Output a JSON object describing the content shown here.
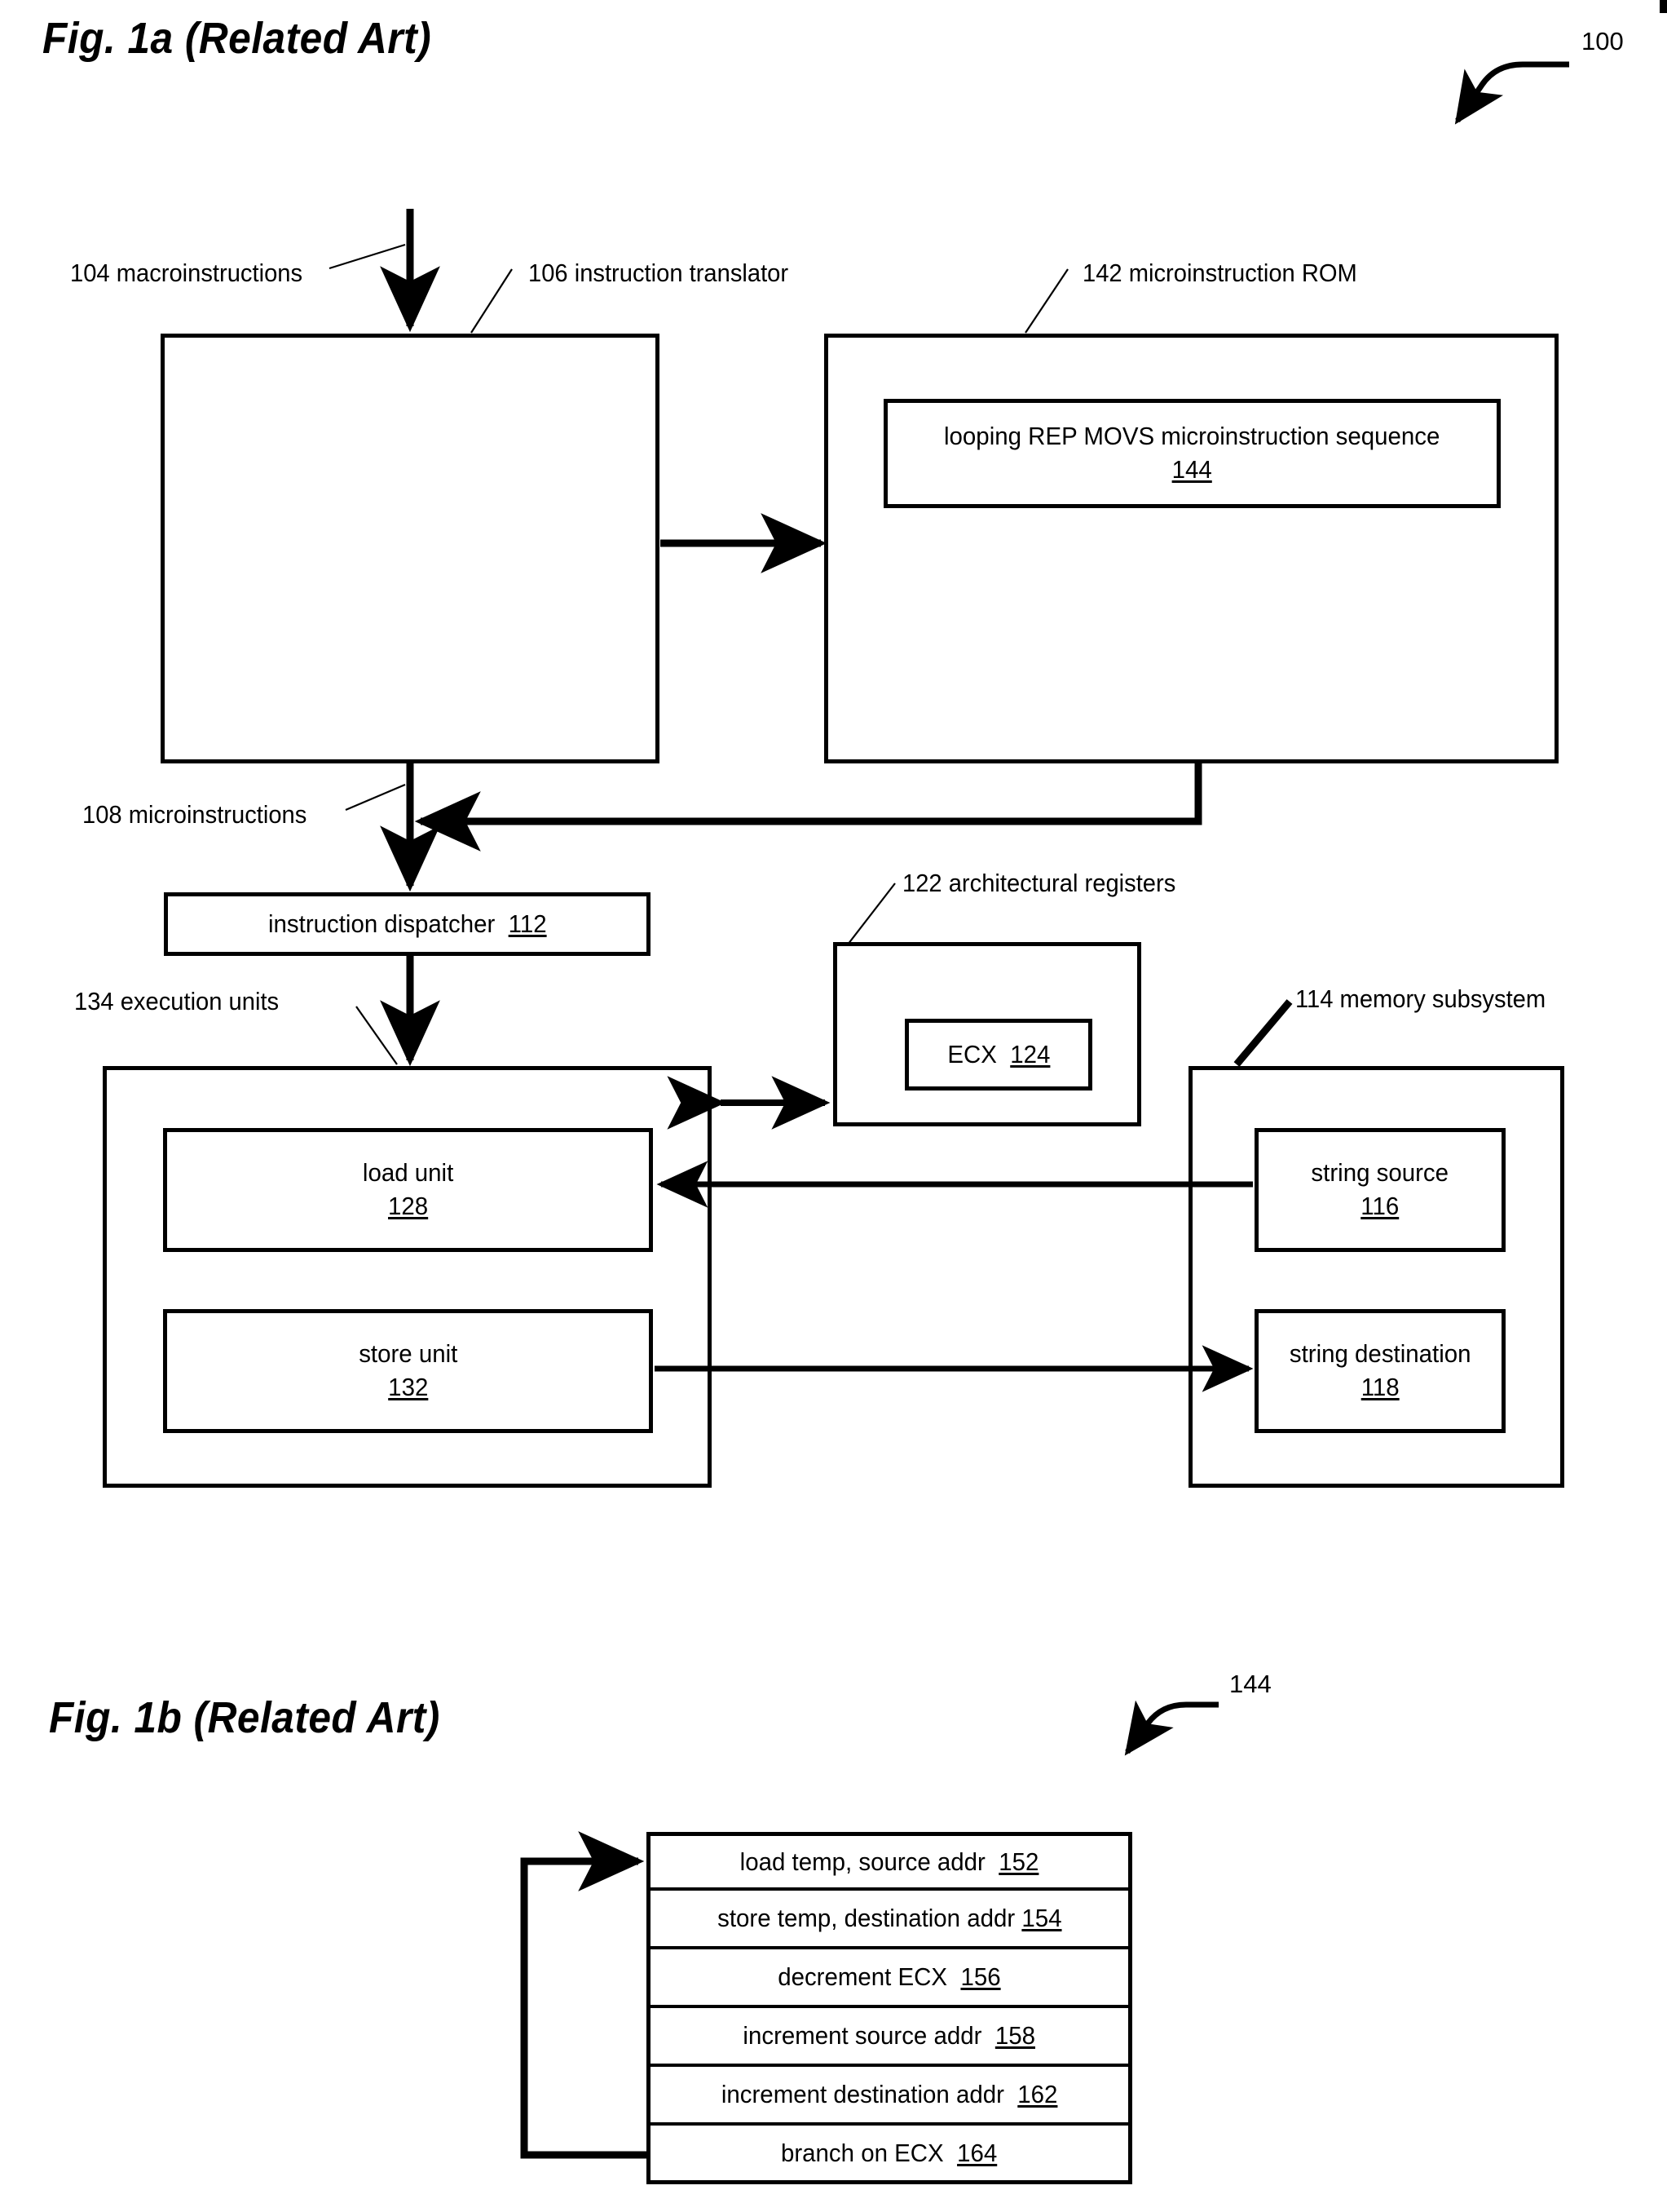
{
  "figures": [
    {
      "id": "fig-1a",
      "title": "Fig. 1a (Related Art)",
      "callout": "100"
    },
    {
      "id": "fig-1b",
      "title": "Fig. 1b (Related Art)",
      "callout": "144"
    }
  ],
  "fig1a": {
    "title": "Fig. 1a (Related Art)",
    "callout_number": "100",
    "labels": {
      "macroinstructions": "104 macroinstructions",
      "instruction_translator": "106  instruction translator",
      "microinstruction_rom": "142  microinstruction ROM",
      "microinstructions": "108 microinstructions",
      "architectural_registers": "122 architectural registers",
      "execution_units": "134 execution units",
      "memory_subsystem": "114 memory subsystem"
    },
    "boxes": {
      "instruction_translator": {
        "text": "",
        "ref": "106"
      },
      "microinstruction_rom": {
        "text": "",
        "ref": "142"
      },
      "rep_movs_sequence": {
        "line1": "looping REP MOVS microinstruction sequence",
        "ref": "144"
      },
      "instruction_dispatcher": {
        "line1": "instruction dispatcher",
        "ref": "112"
      },
      "ecx": {
        "line1": "ECX",
        "ref": "124"
      },
      "load_unit": {
        "line1": "load unit",
        "ref": "128"
      },
      "store_unit": {
        "line1": "store unit",
        "ref": "132"
      },
      "string_source": {
        "line1": "string source",
        "ref": "116"
      },
      "string_destination": {
        "line1": "string destination",
        "ref": "118"
      }
    }
  },
  "fig1b": {
    "title": "Fig. 1b (Related Art)",
    "callout_number": "144",
    "sequence_rows": [
      {
        "text": "load temp, source addr",
        "ref": "152"
      },
      {
        "text": "store temp, destination addr",
        "ref": "154"
      },
      {
        "text": "decrement ECX",
        "ref": "156"
      },
      {
        "text": "increment source addr",
        "ref": "158"
      },
      {
        "text": "increment destination addr",
        "ref": "162"
      },
      {
        "text": "branch on ECX",
        "ref": "164"
      }
    ]
  },
  "colors": {
    "ink": "#000000",
    "paper": "#ffffff"
  }
}
